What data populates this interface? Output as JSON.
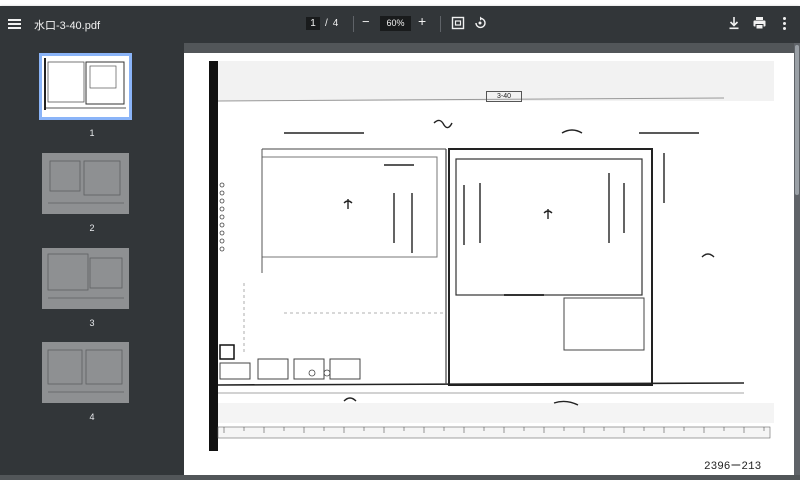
{
  "toolbar": {
    "menu_icon": "hamburger-menu-icon",
    "title": "水口-3-40.pdf",
    "current_page": "1",
    "page_separator": "/",
    "total_pages": "4",
    "zoom_out": "−",
    "zoom": "60%",
    "zoom_in": "+",
    "fit_icon": "fit-to-page-icon",
    "rotate_icon": "rotate-icon",
    "download_icon": "download-icon",
    "print_icon": "print-icon",
    "more_icon": "more-vert-icon"
  },
  "sidebar": {
    "thumbnails": [
      {
        "label": "1",
        "active": true
      },
      {
        "label": "2",
        "active": false
      },
      {
        "label": "3",
        "active": false
      },
      {
        "label": "4",
        "active": false
      }
    ]
  },
  "document": {
    "sheet_label": "3-40",
    "page_id": "2396ー213"
  },
  "colors": {
    "toolbar_bg": "#323639",
    "viewer_bg": "#525659",
    "active_thumb_outline": "#8ab4f8"
  }
}
